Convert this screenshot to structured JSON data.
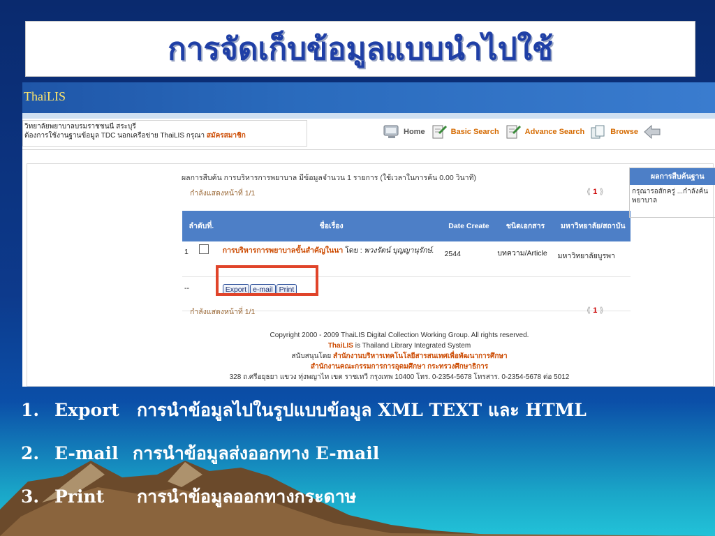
{
  "slide_title": "การจัดเก็บข้อมูลแบบนำไปใช้",
  "header": {
    "logo": "ThaiLIS"
  },
  "info": {
    "line1": "วิทยาลัยพยาบาลบรมราชชนนี สระบุรี",
    "line2": "ต้องการใช้งานฐานข้อมูล TDC นอกเครือข่าย ThaiLIS กรุณา",
    "link": "สมัครสมาชิก"
  },
  "nav": [
    {
      "label": "Home",
      "icon": "monitor-icon"
    },
    {
      "label": "Basic Search",
      "icon": "document-search-icon"
    },
    {
      "label": "Advance Search",
      "icon": "document-search-icon"
    },
    {
      "label": "Browse",
      "icon": "document-stack-icon"
    },
    {
      "label": "",
      "icon": "back-arrow-icon"
    }
  ],
  "results": {
    "summary": "ผลการสืบค้น การบริหารการพยาบาล มีข้อมูลจำนวน 1 รายการ (ใช้เวลาในการค้น 0.00 วินาที)",
    "page_label": "กำลังแสดงหน้าที่ 1/1",
    "page_label_bottom": "กำลังแสดงหน้าที่ 1/1",
    "current_page": "1",
    "columns": [
      "ลำดับที่.",
      "ชื่อเรื่อง",
      "Date Create",
      "ชนิดเอกสาร",
      "มหาวิทยาลัย/สถาบัน"
    ],
    "row": {
      "no": "1",
      "title": "การบริหารการพยาบาลขั้นสำคัญในนา",
      "by": "โดย :",
      "author": "พวงรัตน์ บุญญานุรักษ์.",
      "date": "2544",
      "type": "บทความ/Article",
      "institution": "มหาวิทยาลัยบูรพา"
    },
    "action_row_label": "--",
    "buttons": [
      "Export",
      "e-mail",
      "Print"
    ]
  },
  "side_panel": {
    "header": "ผลการสืบค้นฐาน",
    "body": "กรุณารอสักครู่ ...กำลังค้น พยาบาล"
  },
  "footer": {
    "copyright": "Copyright 2000 - 2009 ThaiLIS Digital Collection Working Group. All rights reserved.",
    "thailis_word": "ThaiLIS",
    "thailis_rest": "is Thailand Library Integrated System",
    "support_prefix": "สนับสนุนโดย",
    "support_org1": "สำนักงานบริหารเทคโนโลยีสารสนเทศเพื่อพัฒนาการศึกษา",
    "support_org2": "สำนักงานคณะกรรมการการอุดมศึกษา กระทรวงศึกษาธิการ",
    "address": "328 ถ.ศรีอยุธยา แขวง ทุ่งพญาไท เขต ราชเทวี กรุงเทพ 10400 โทร. 0-2354-5678 โทรสาร. 0-2354-5678 ต่อ 5012"
  },
  "list": [
    {
      "num": "1.",
      "key": "Export",
      "desc": "การนำข้อมูลไปในรูปแบบข้อมูล  XML TEXT และ HTML"
    },
    {
      "num": "2.",
      "key": "E-mail",
      "desc": "การนำข้อมูลส่งออกทาง E-mail"
    },
    {
      "num": "3.",
      "key": "Print",
      "desc": "การนำข้อมูลออกทางกระดาษ"
    }
  ]
}
